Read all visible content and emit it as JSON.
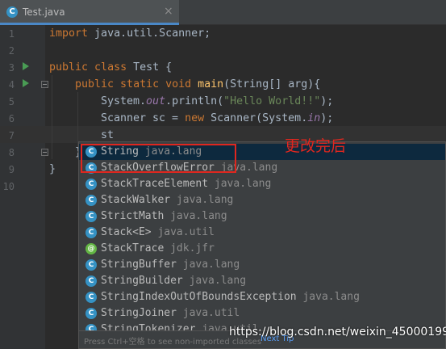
{
  "tab": {
    "icon": "java-class-icon",
    "icon_glyph": "C",
    "label": "Test.java",
    "close": "×"
  },
  "lines": [
    "1",
    "2",
    "3",
    "4",
    "5",
    "6",
    "7",
    "8",
    "9",
    "10"
  ],
  "code": {
    "l1": {
      "kw": "import",
      "rest": " java.util.Scanner;"
    },
    "l3": {
      "kw1": "public",
      "kw2": " class",
      "rest": " Test {"
    },
    "l4": {
      "kw1": "public",
      "kw2": " static",
      "kw3": " void",
      "fn": " main",
      "rest": "(String[] arg){"
    },
    "l5": {
      "a": "System.",
      "fld": "out",
      "b": ".println(",
      "str": "\"Hello World!!\"",
      "c": ");"
    },
    "l6": {
      "a": "Scanner sc = ",
      "kw": "new",
      "b": " Scanner(System.",
      "fld": "in",
      "c": ");"
    },
    "l7": {
      "text": "st"
    },
    "l8": {
      "text": "}"
    },
    "l9": {
      "text": "}"
    }
  },
  "completion": {
    "items": [
      {
        "name": "String",
        "pkg": "java.lang",
        "icon": "class-icon"
      },
      {
        "name": "StackOverflowError",
        "pkg": "java.lang",
        "icon": "class-icon"
      },
      {
        "name": "StackTraceElement",
        "pkg": "java.lang",
        "icon": "class-icon"
      },
      {
        "name": "StackWalker",
        "pkg": "java.lang",
        "icon": "class-icon"
      },
      {
        "name": "StrictMath",
        "pkg": "java.lang",
        "icon": "class-icon"
      },
      {
        "name": "Stack<E>",
        "pkg": "java.util",
        "icon": "class-icon"
      },
      {
        "name": "StackTrace",
        "pkg": "jdk.jfr",
        "icon": "annotation-icon"
      },
      {
        "name": "StringBuffer",
        "pkg": "java.lang",
        "icon": "class-icon"
      },
      {
        "name": "StringBuilder",
        "pkg": "java.lang",
        "icon": "class-icon"
      },
      {
        "name": "StringIndexOutOfBoundsException",
        "pkg": "java.lang",
        "icon": "class-icon"
      },
      {
        "name": "StringJoiner",
        "pkg": "java.util",
        "icon": "class-icon"
      },
      {
        "name": "StringTokenizer",
        "pkg": "java.util",
        "icon": "class-icon"
      }
    ],
    "hint": "Press Ctrl+空格 to see non-imported classes",
    "hint_link": "Next Tip"
  },
  "annotation": "更改完后",
  "watermark": "https://blog.csdn.net/weixin_45000199",
  "colors": {
    "accent": "#4a88c7",
    "keyword": "#cc7832",
    "string": "#6a8759",
    "highlight": "#e0271f"
  }
}
